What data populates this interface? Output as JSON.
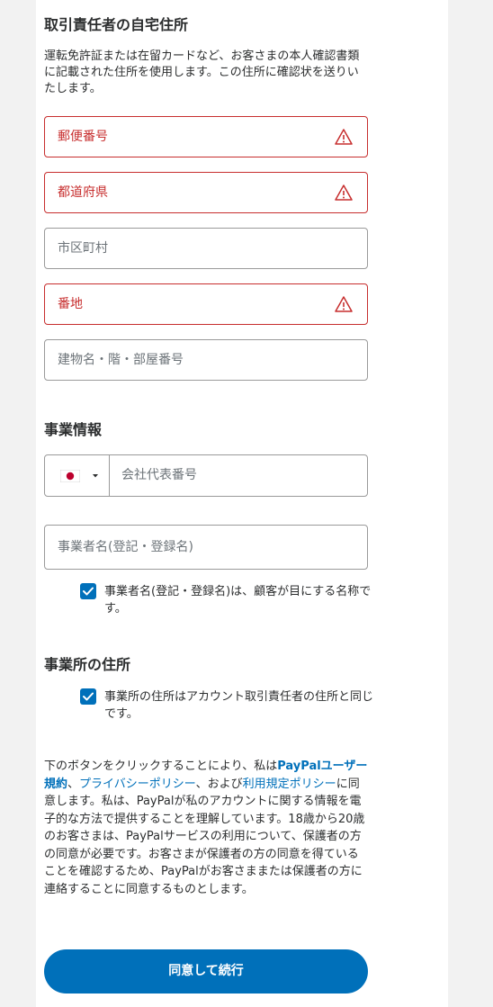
{
  "home_address": {
    "title": "取引責任者の自宅住所",
    "description": "運転免許証または在留カードなど、お客さまの本人確認書類に記載された住所を使用します。この住所に確認状を送りいたします。",
    "fields": {
      "postal_code": "郵便番号",
      "prefecture": "都道府県",
      "city": "市区町村",
      "street": "番地",
      "building": "建物名・階・部屋番号"
    }
  },
  "business_info": {
    "title": "事業情報",
    "phone_placeholder": "会社代表番号",
    "business_name_placeholder": "事業者名(登記・登録名)",
    "business_name_checkbox": "事業者名(登記・登録名)は、顧客が目にする名称です。"
  },
  "business_address": {
    "title": "事業所の住所",
    "same_address_checkbox": "事業所の住所はアカウント取引責任者の住所と同じです。"
  },
  "legal": {
    "part1": "下のボタンをクリックすることにより、私は",
    "link1": "PayPalユーザー規約",
    "sep1": "、",
    "link2": "プライバシーポリシー",
    "sep2": "、および",
    "link3": "利用規定ポリシー",
    "part2": "に同意します。私は、PayPalが私のアカウントに関する情報を電子的な方法で提供することを理解しています。18歳から20歳のお客さまは、PayPalサービスの利用について、保護者の方の同意が必要です。お客さまが保護者の方の同意を得ていることを確認するため、PayPalがお客さままたは保護者の方に連絡することに同意するものとします。"
  },
  "submit_button": "同意して続行",
  "colors": {
    "accent": "#0070ba",
    "error": "#c72e2e"
  },
  "icons": [
    "warning-icon",
    "japan-flag-icon",
    "caret-down-icon",
    "checkmark-icon"
  ]
}
